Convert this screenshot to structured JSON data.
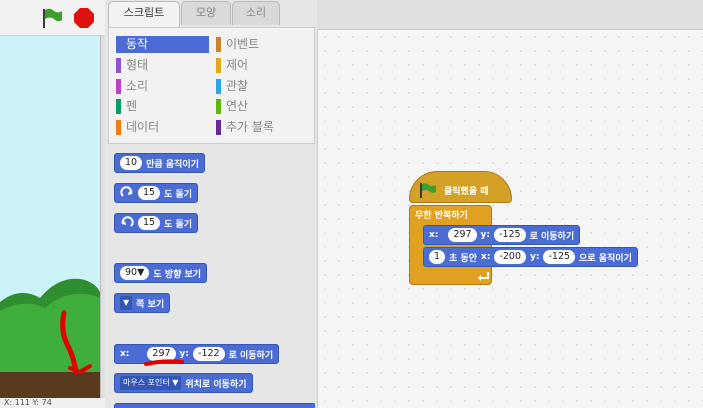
{
  "tabs": [
    "스크립트",
    "모양",
    "소리"
  ],
  "categories": [
    {
      "label": "동작",
      "color": "#4a6cd4",
      "active": true
    },
    {
      "label": "이벤트",
      "color": "#c88330"
    },
    {
      "label": "형태",
      "color": "#8a55d7"
    },
    {
      "label": "제어",
      "color": "#e1a91a"
    },
    {
      "label": "소리",
      "color": "#bb42c3"
    },
    {
      "label": "관찰",
      "color": "#2ca5e2"
    },
    {
      "label": "펜",
      "color": "#0e9a6c"
    },
    {
      "label": "연산",
      "color": "#5cb712"
    },
    {
      "label": "데이터",
      "color": "#ee7d16"
    },
    {
      "label": "추가 블록",
      "color": "#632d99"
    }
  ],
  "palette": {
    "move_steps": {
      "value": "10",
      "text": "만큼 움직이기"
    },
    "turn_right": {
      "value": "15",
      "text": "도 돌기"
    },
    "turn_left": {
      "value": "15",
      "text": "도 돌기"
    },
    "point_dir": {
      "value": "90▼",
      "text": "도 방향 보기"
    },
    "point_towards": {
      "text": "쪽 보기"
    },
    "goto_xy": {
      "xlabel": "x:",
      "x": "297",
      "ylabel": "y:",
      "y": "-122",
      "text": "로 이동하기"
    },
    "goto_target": {
      "value": "마우스 포인터",
      "text": "위치로 이동하기"
    }
  },
  "script": {
    "hat_text": "클릭했을 때",
    "forever_text": "무한 반복하기",
    "goto": {
      "xlabel": "x:",
      "x": "297",
      "ylabel": "y:",
      "y": "-125",
      "text": "로 이동하기"
    },
    "glide": {
      "secs": "1",
      "t1": "초 동안",
      "xlabel": "x:",
      "x": "-200",
      "ylabel": "y:",
      "y": "-125",
      "text": "으로 움직이기"
    }
  },
  "stage": {
    "x_label": "X:",
    "x": "111",
    "y_label": "Y:",
    "y": "74"
  }
}
